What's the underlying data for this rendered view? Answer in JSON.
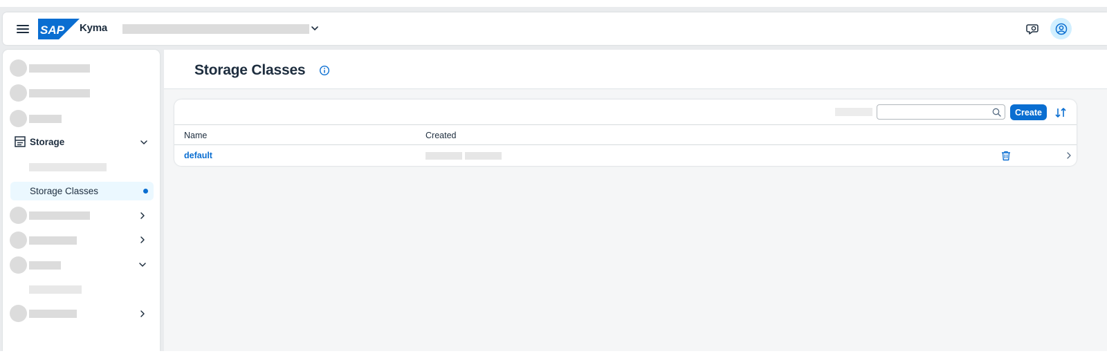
{
  "shellbar": {
    "product_name": "Kyma",
    "logo_text": "SAP",
    "colors": {
      "logo_blue": "#0a6ed1",
      "avatar_bg": "#d1efff"
    }
  },
  "sidebar": {
    "storage_group": {
      "label": "Storage",
      "icon": "storage-icon",
      "expanded": true
    },
    "active_item": {
      "label": "Storage Classes"
    }
  },
  "page": {
    "title": "Storage Classes",
    "info_icon": "info-icon"
  },
  "toolbar": {
    "search_placeholder": "",
    "create_label": "Create",
    "sort_icon": "sort-icon"
  },
  "table": {
    "columns": [
      "Name",
      "Created"
    ],
    "rows": [
      {
        "name": "default"
      }
    ]
  },
  "colors": {
    "accent": "#0a6ed1",
    "active_nav_bg": "#ebf8ff",
    "page_bg": "#f5f6f7",
    "skeleton": "#dcdcdc"
  }
}
